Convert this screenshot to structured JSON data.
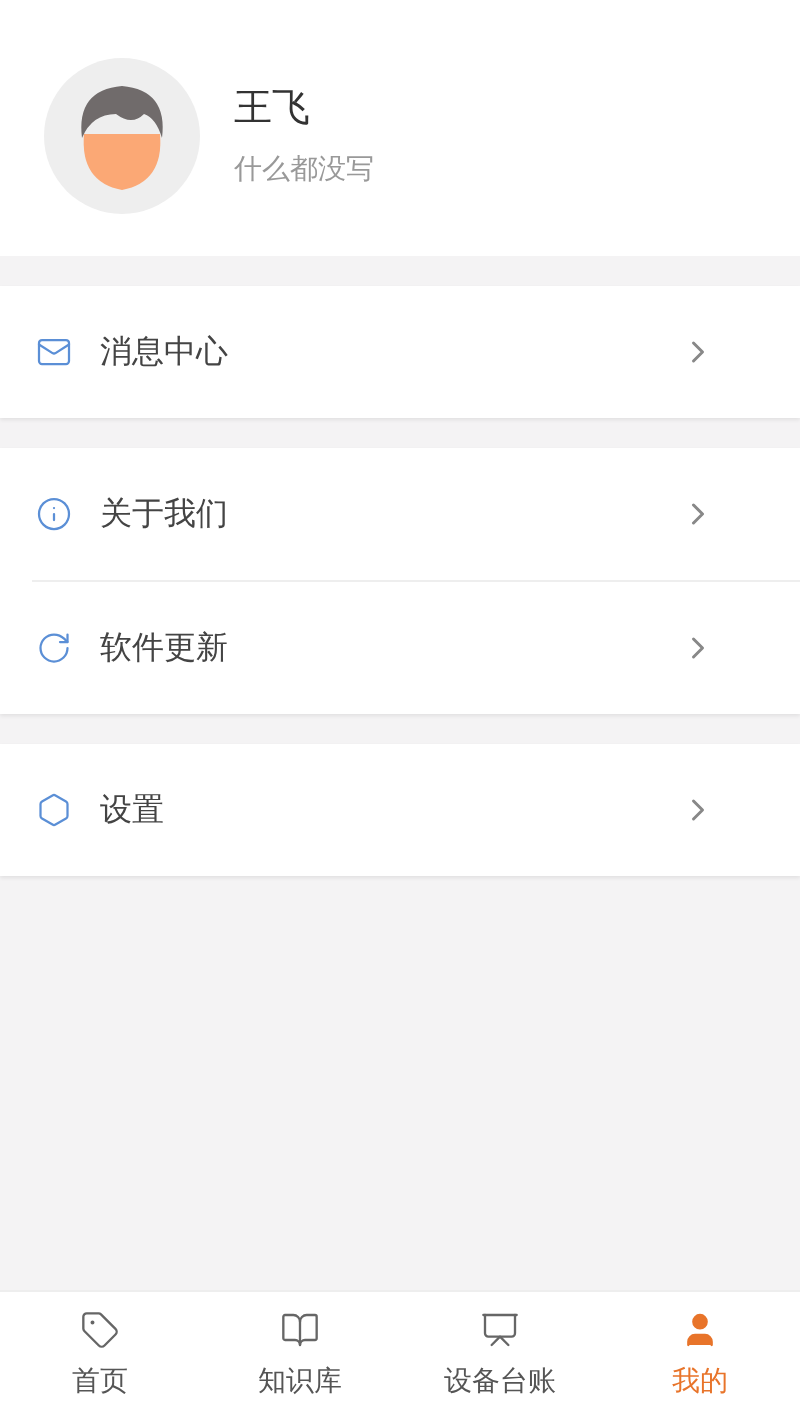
{
  "profile": {
    "name": "王飞",
    "bio": "什么都没写"
  },
  "groups": [
    {
      "items": [
        {
          "label": "消息中心"
        }
      ]
    },
    {
      "items": [
        {
          "label": "关于我们"
        },
        {
          "label": "软件更新"
        }
      ]
    },
    {
      "items": [
        {
          "label": "设置"
        }
      ]
    }
  ],
  "tab_bar": [
    {
      "label": "首页",
      "selected": false
    },
    {
      "label": "知识库",
      "selected": false
    },
    {
      "label": "设备台账",
      "selected": false
    },
    {
      "label": "我的",
      "selected": true
    }
  ]
}
